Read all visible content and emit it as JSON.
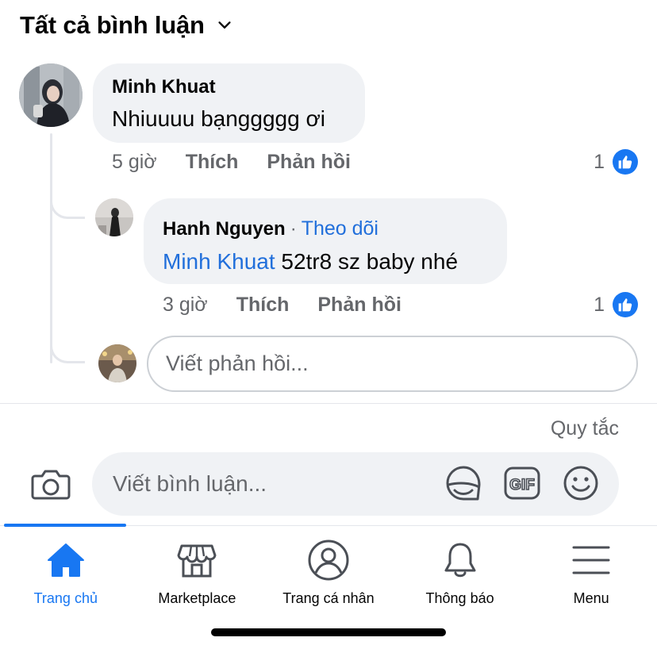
{
  "header": {
    "filter_label": "Tất cả bình luận"
  },
  "comments": [
    {
      "author": "Minh Khuat",
      "text": "Nhiuuuu bạnggggg ơi",
      "time": "5 giờ",
      "like_action": "Thích",
      "reply_action": "Phản hồi",
      "reaction_count": "1"
    }
  ],
  "reply": {
    "author": "Hanh Nguyen",
    "separator": "·",
    "follow_label": "Theo dõi",
    "mention": "Minh Khuat",
    "text": "52tr8 sz baby nhé",
    "time": "3 giờ",
    "like_action": "Thích",
    "reply_action": "Phản hồi",
    "reaction_count": "1"
  },
  "reply_box": {
    "placeholder": "Viết phản hồi..."
  },
  "rules_link": "Quy tắc",
  "composer": {
    "placeholder": "Viết bình luận..."
  },
  "nav": {
    "items": [
      {
        "label": "Trang chủ",
        "icon": "home-icon",
        "active": true
      },
      {
        "label": "Marketplace",
        "icon": "marketplace-icon"
      },
      {
        "label": "Trang cá nhân",
        "icon": "profile-icon"
      },
      {
        "label": "Thông báo",
        "icon": "bell-icon"
      },
      {
        "label": "Menu",
        "icon": "menu-icon"
      }
    ]
  },
  "colors": {
    "accent": "#1877f2",
    "link": "#216fdb",
    "bubble": "#f0f2f5",
    "secondary_text": "#65676b"
  }
}
